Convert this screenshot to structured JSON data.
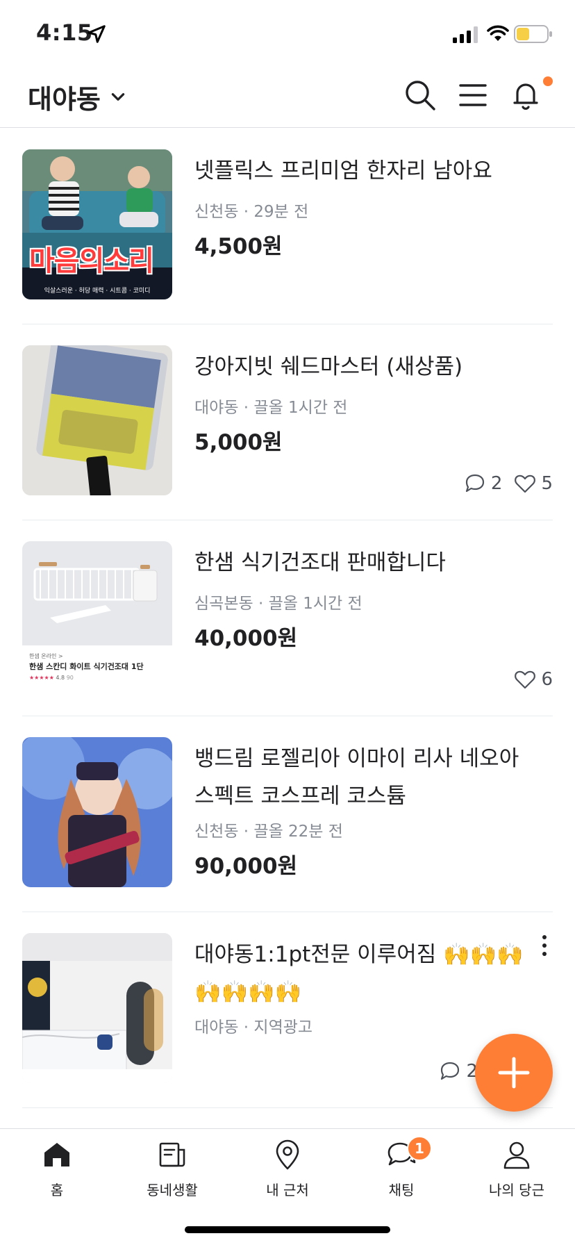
{
  "status": {
    "time": "4:15"
  },
  "header": {
    "location": "대야동"
  },
  "colors": {
    "accent": "#ff7e36",
    "meta": "#868b94",
    "text": "#212124"
  },
  "items": [
    {
      "title": "넷플릭스 프리미엄 한자리 남아요",
      "meta": "신천동 · 29분 전",
      "price": "4,500원",
      "thumb_text": "마음의소리",
      "thumb_sub": "익살스러운 · 허당 매력 · 시트콤 · 코미디"
    },
    {
      "title": "강아지빗 쉐드마스터 (새상품)",
      "meta": "대야동 · 끌올 1시간 전",
      "price": "5,000원",
      "comments": "2",
      "likes": "5"
    },
    {
      "title": "한샘 식기건조대 판매합니다",
      "meta": "심곡본동 · 끌올 1시간 전",
      "price": "40,000원",
      "likes": "6",
      "thumb_brand": "한샘 온라인 >",
      "thumb_name": "한샘 스칸디 화이트 식기건조대 1단",
      "thumb_rating": "4.8",
      "thumb_reviews": "90"
    },
    {
      "title": "뱅드림 로젤리아 이마이 리사 네오아스펙트 코스프레 코스튬",
      "meta": "신천동 · 끌올 22분 전",
      "price": "90,000원"
    },
    {
      "title": "대야동1:1pt전문 이루어짐 🙌🙌🙌🙌🙌🙌🙌",
      "meta": "대야동 · 지역광고",
      "comments": "2"
    }
  ],
  "nav": [
    {
      "label": "홈",
      "icon": "home-icon"
    },
    {
      "label": "동네생활",
      "icon": "newspaper-icon"
    },
    {
      "label": "내 근처",
      "icon": "map-pin-icon"
    },
    {
      "label": "채팅",
      "icon": "chat-icon",
      "badge": "1"
    },
    {
      "label": "나의 당근",
      "icon": "person-icon"
    }
  ]
}
